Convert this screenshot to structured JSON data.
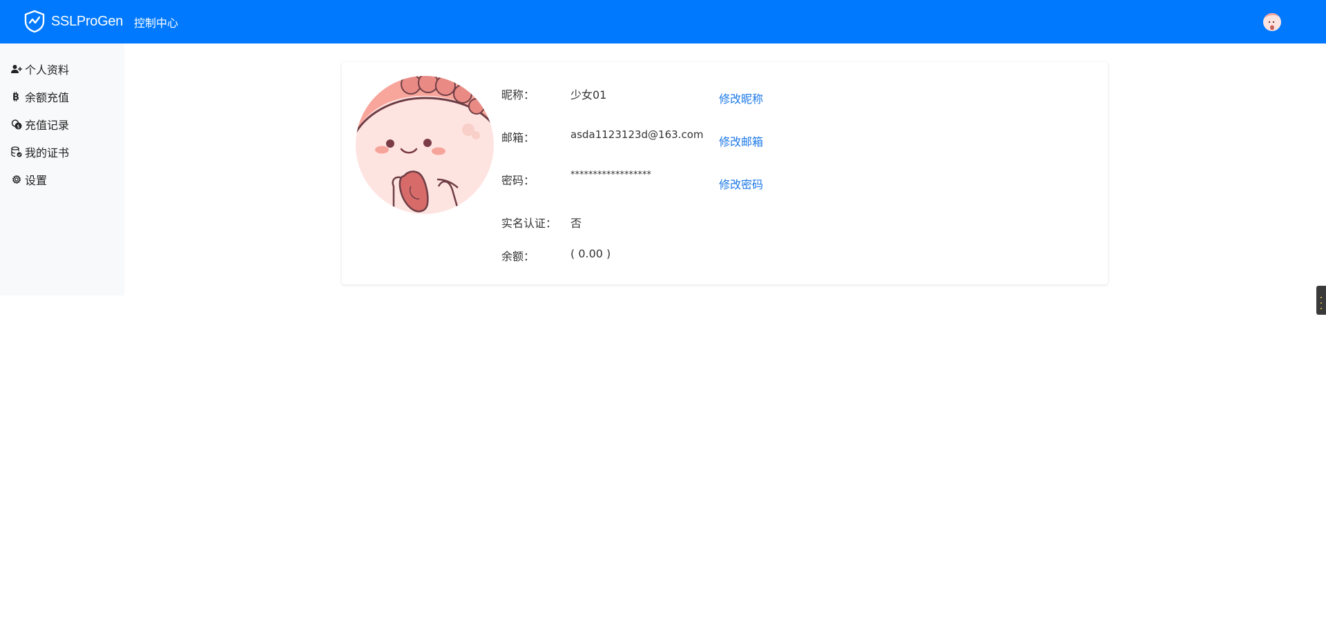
{
  "header": {
    "brand": "SSLProGen",
    "nav": "控制中心",
    "accent": "#0079fe"
  },
  "sidebar": {
    "items": [
      {
        "label": "个人资料",
        "icon": "user-plus-icon"
      },
      {
        "label": "余额充值",
        "icon": "bitcoin-icon"
      },
      {
        "label": "充值记录",
        "icon": "coins-icon"
      },
      {
        "label": "我的证书",
        "icon": "database-check-icon"
      },
      {
        "label": "设置",
        "icon": "gear-icon"
      }
    ]
  },
  "profile": {
    "nickname_label": "昵称：",
    "nickname_value": "少女01",
    "nickname_action": "修改昵称",
    "email_label": "邮箱：",
    "email_value": "asda1123123d@163.com",
    "email_action": "修改邮箱",
    "password_label": "密码：",
    "password_value": "******************",
    "password_action": "修改密码",
    "realname_label": "实名认证：",
    "realname_value": "否",
    "balance_label": "余额：",
    "balance_value": "( 0.00 )",
    "link_color": "#1a78e8"
  }
}
